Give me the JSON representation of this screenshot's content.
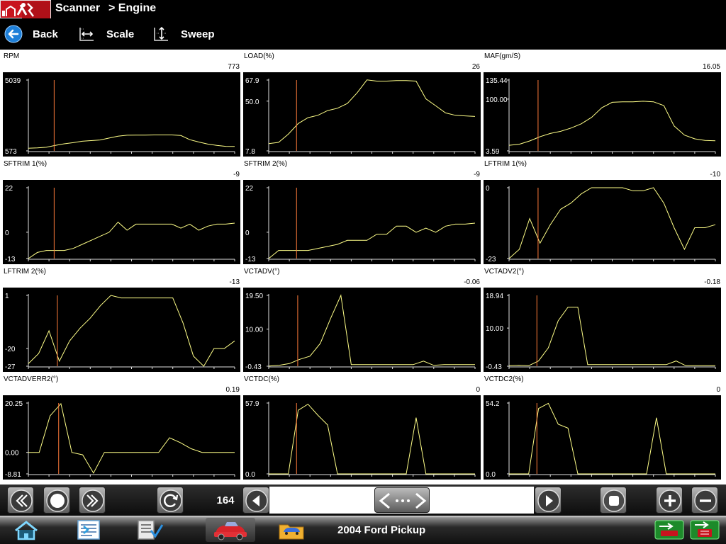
{
  "titlebar": {
    "title": "Scanner",
    "breadcrumb": "> Engine"
  },
  "toolbar": {
    "back_label": "Back",
    "scale_label": "Scale",
    "sweep_label": "Sweep"
  },
  "colors": {
    "trace": "#ffff88",
    "cursor": "#ff7b3a",
    "plot_bg": "#000000",
    "panel_bg": "#ffffff",
    "brand_red": "#c8141e"
  },
  "cursor_sample_index": 3,
  "graphs": [
    {
      "name": "RPM",
      "value": "773",
      "min": 573,
      "max": 5039,
      "tick_labels": [
        "5039",
        "573"
      ],
      "tick_values": [
        5039,
        573
      ],
      "values": [
        740,
        760,
        800,
        920,
        1020,
        1090,
        1180,
        1220,
        1260,
        1380,
        1500,
        1560,
        1570,
        1570,
        1580,
        1580,
        1580,
        1540,
        1280,
        1130,
        1000,
        920,
        860,
        850
      ]
    },
    {
      "name": "LOAD(%)",
      "value": "26",
      "min": 7.8,
      "max": 67.9,
      "tick_labels": [
        "67.9",
        "50.0",
        "7.8"
      ],
      "tick_values": [
        67.9,
        50.0,
        7.8
      ],
      "values": [
        14,
        15,
        22,
        31,
        36,
        38,
        42,
        44,
        48,
        57,
        68,
        67,
        67,
        67.5,
        67.5,
        67,
        52,
        46,
        40,
        38,
        37.5,
        37
      ]
    },
    {
      "name": "MAF(gm/S)",
      "value": "16.05",
      "min": 3.59,
      "max": 135.44,
      "tick_labels": [
        "135.44",
        "100.00",
        "3.59"
      ],
      "tick_values": [
        135.44,
        100.0,
        3.59
      ],
      "values": [
        14,
        16,
        22,
        30,
        36,
        40,
        46,
        54,
        66,
        84,
        94,
        95,
        95,
        96,
        95,
        88,
        50,
        33,
        26,
        23,
        22.5
      ]
    },
    {
      "name": "SFTRIM 1(%)",
      "value": "-9",
      "min": -13,
      "max": 22,
      "tick_labels": [
        "22",
        "0",
        "-13"
      ],
      "tick_values": [
        22,
        0,
        -13
      ],
      "values": [
        -13,
        -10,
        -9,
        -9,
        -9,
        -8,
        -6,
        -4,
        -2,
        0,
        5,
        1,
        4,
        4,
        4,
        4,
        4,
        2,
        4,
        1,
        3,
        4,
        4,
        4.5
      ]
    },
    {
      "name": "SFTRIM 2(%)",
      "value": "-9",
      "min": -13,
      "max": 22,
      "tick_labels": [
        "22",
        "0",
        "-13"
      ],
      "tick_values": [
        22,
        0,
        -13
      ],
      "values": [
        -13,
        -9,
        -9,
        -9,
        -9,
        -8,
        -7,
        -6,
        -4,
        -4,
        -4,
        -1,
        -1,
        3,
        3,
        0,
        2,
        0,
        3,
        4,
        4,
        4.5
      ]
    },
    {
      "name": "LFTRIM 1(%)",
      "value": "-10",
      "min": -23,
      "max": 0,
      "tick_labels": [
        "0",
        "-23"
      ],
      "tick_values": [
        0,
        -23
      ],
      "values": [
        -23,
        -20,
        -10,
        -18,
        -12,
        -7,
        -5,
        -2,
        0,
        0,
        0,
        0,
        -1,
        -1,
        0,
        -5,
        -13,
        -20,
        -13,
        -13,
        -12
      ]
    },
    {
      "name": "LFTRIM 2(%)",
      "value": "-13",
      "min": -27,
      "max": 1,
      "tick_labels": [
        "1",
        "-20",
        "-27"
      ],
      "tick_values": [
        1,
        -20,
        -27
      ],
      "values": [
        -26,
        -22,
        -13,
        -25,
        -17,
        -12,
        -8,
        -3,
        1,
        0,
        0,
        0,
        0,
        0,
        0,
        -10,
        -23,
        -27,
        -20,
        -20,
        -17
      ]
    },
    {
      "name": "VCTADV(°)",
      "value": "-0.06",
      "min": -0.43,
      "max": 19.5,
      "tick_labels": [
        "19.50",
        "10.00",
        "-0.43"
      ],
      "tick_values": [
        19.5,
        10.0,
        -0.43
      ],
      "values": [
        -0.4,
        -0.2,
        0.3,
        1.5,
        2.4,
        6,
        13,
        19.5,
        0,
        0,
        0,
        0,
        0,
        0,
        0,
        1,
        -0.2,
        0,
        0,
        0,
        0
      ]
    },
    {
      "name": "VCTADV2(°)",
      "value": "-0.18",
      "min": -0.43,
      "max": 18.94,
      "tick_labels": [
        "18.94",
        "10.00",
        "-0.43"
      ],
      "tick_values": [
        18.94,
        10.0,
        -0.43
      ],
      "values": [
        -0.3,
        -0.2,
        -0.3,
        1,
        4.6,
        12,
        15.7,
        15.7,
        0,
        0,
        0,
        0,
        0,
        0,
        0,
        0,
        0,
        1,
        -0.3,
        -0.3,
        -0.3,
        -0.3
      ]
    },
    {
      "name": "VCTADVERR2(°)",
      "value": "0.19",
      "min": -8.81,
      "max": 20.25,
      "tick_labels": [
        "20.25",
        "0.00",
        "-8.81"
      ],
      "tick_values": [
        20.25,
        0.0,
        -8.81
      ],
      "values": [
        0,
        0,
        15,
        20,
        0,
        -1,
        -8.5,
        0,
        0,
        0,
        0,
        0,
        0,
        6,
        4,
        1.5,
        0,
        0,
        0,
        0
      ]
    },
    {
      "name": "VCTDC(%)",
      "value": "0",
      "min": 0,
      "max": 57.9,
      "tick_labels": [
        "57.9",
        "0.0"
      ],
      "tick_values": [
        57.9,
        0.0
      ],
      "values": [
        0,
        0,
        0,
        52,
        57,
        48,
        40,
        0,
        0,
        0,
        0,
        0,
        0,
        0,
        0,
        46,
        0,
        0,
        0,
        0,
        0,
        0
      ]
    },
    {
      "name": "VCTDC2(%)",
      "value": "0",
      "min": 0,
      "max": 54.2,
      "tick_labels": [
        "54.2",
        "0.0"
      ],
      "tick_values": [
        54.2,
        0.0
      ],
      "values": [
        0,
        0,
        0,
        50,
        54,
        38,
        35,
        0,
        0,
        0,
        0,
        0,
        0,
        0,
        0,
        43,
        0,
        0,
        0,
        0,
        0,
        0
      ]
    }
  ],
  "controls": {
    "frame_count": "164"
  },
  "taskbar": {
    "vehicle": "2004 Ford Pickup"
  }
}
